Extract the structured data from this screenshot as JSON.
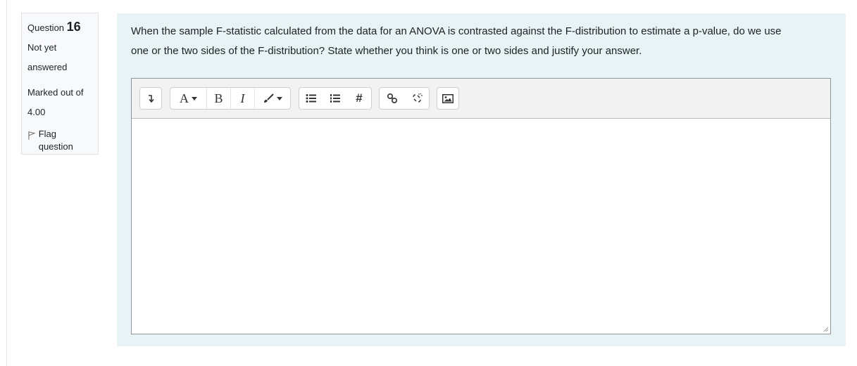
{
  "question": {
    "label": "Question",
    "number": "16",
    "state_line1": "Not yet",
    "state_line2": "answered",
    "grade_line1": "Marked out of",
    "grade_line2": "4.00",
    "flag_label": "Flag question"
  },
  "content": {
    "text_line1": "When the sample F-statistic calculated from the data for an ANOVA is contrasted against the F-distribution to estimate a p-value, do we use",
    "text_line2": "one or the two sides of the F-distribution?  State whether you think is one or two sides and justify your answer."
  },
  "editor": {
    "toolbar": {
      "font_label": "A",
      "bold_label": "B",
      "italic_label": "I",
      "hash_label": "#"
    },
    "value": "",
    "icons": [
      "collapse-icon",
      "font-icon",
      "bold-icon",
      "italic-icon",
      "paintbrush-icon",
      "bullet-list-icon",
      "numbered-list-icon",
      "hash-icon",
      "link-icon",
      "unlink-icon",
      "image-icon"
    ]
  },
  "colors": {
    "content_bg": "#e7f3f5",
    "info_bg": "#f8f9fa",
    "toolbar_bg": "#f2f2f2"
  }
}
